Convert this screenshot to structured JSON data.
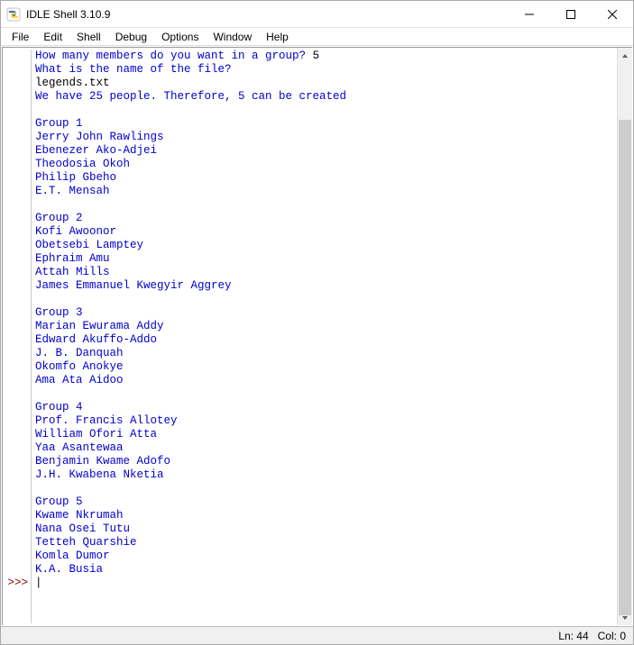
{
  "window": {
    "title": "IDLE Shell 3.10.9"
  },
  "menubar": {
    "items": [
      "File",
      "Edit",
      "Shell",
      "Debug",
      "Options",
      "Window",
      "Help"
    ]
  },
  "shell": {
    "prompt": ">>>",
    "lines": [
      {
        "text": "How many members do you want in a group? ",
        "cls": "blue",
        "tail": "5",
        "tailcls": "black"
      },
      {
        "text": "What is the name of the file?",
        "cls": "blue"
      },
      {
        "text": "legends.txt",
        "cls": "black"
      },
      {
        "text": "We have 25 people. Therefore, 5 can be created",
        "cls": "blue"
      },
      {
        "text": "",
        "cls": "blue"
      },
      {
        "text": "Group 1",
        "cls": "blue"
      },
      {
        "text": "Jerry John Rawlings",
        "cls": "blue"
      },
      {
        "text": "Ebenezer Ako-Adjei",
        "cls": "blue"
      },
      {
        "text": "Theodosia Okoh",
        "cls": "blue"
      },
      {
        "text": "Philip Gbeho",
        "cls": "blue"
      },
      {
        "text": "E.T. Mensah",
        "cls": "blue"
      },
      {
        "text": "",
        "cls": "blue"
      },
      {
        "text": "Group 2",
        "cls": "blue"
      },
      {
        "text": "Kofi Awoonor",
        "cls": "blue"
      },
      {
        "text": "Obetsebi Lamptey",
        "cls": "blue"
      },
      {
        "text": "Ephraim Amu",
        "cls": "blue"
      },
      {
        "text": "Attah Mills",
        "cls": "blue"
      },
      {
        "text": "James Emmanuel Kwegyir Aggrey",
        "cls": "blue"
      },
      {
        "text": "",
        "cls": "blue"
      },
      {
        "text": "Group 3",
        "cls": "blue"
      },
      {
        "text": "Marian Ewurama Addy",
        "cls": "blue"
      },
      {
        "text": "Edward Akuffo-Addo",
        "cls": "blue"
      },
      {
        "text": "J. B. Danquah",
        "cls": "blue"
      },
      {
        "text": "Okomfo Anokye",
        "cls": "blue"
      },
      {
        "text": "Ama Ata Aidoo",
        "cls": "blue"
      },
      {
        "text": "",
        "cls": "blue"
      },
      {
        "text": "Group 4",
        "cls": "blue"
      },
      {
        "text": "Prof. Francis Allotey",
        "cls": "blue"
      },
      {
        "text": "William Ofori Atta",
        "cls": "blue"
      },
      {
        "text": "Yaa Asantewaa",
        "cls": "blue"
      },
      {
        "text": "Benjamin Kwame Adofo",
        "cls": "blue"
      },
      {
        "text": "J.H. Kwabena Nketia",
        "cls": "blue"
      },
      {
        "text": "",
        "cls": "blue"
      },
      {
        "text": "Group 5",
        "cls": "blue"
      },
      {
        "text": "Kwame Nkrumah",
        "cls": "blue"
      },
      {
        "text": "Nana Osei Tutu",
        "cls": "blue"
      },
      {
        "text": "Tetteh Quarshie",
        "cls": "blue"
      },
      {
        "text": "Komla Dumor",
        "cls": "blue"
      },
      {
        "text": "K.A. Busia",
        "cls": "blue"
      }
    ]
  },
  "statusbar": {
    "ln": "Ln: 44",
    "col": "Col: 0"
  }
}
